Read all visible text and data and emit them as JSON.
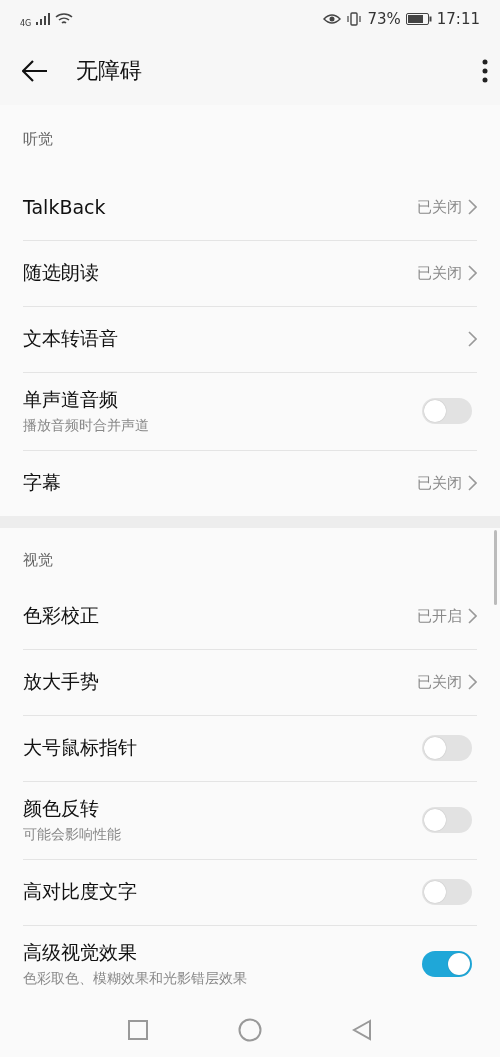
{
  "status_bar": {
    "network": "4G",
    "battery_percent": "73%",
    "time": "17:11"
  },
  "header": {
    "title": "无障碍"
  },
  "sections": [
    {
      "title": "听觉",
      "items": [
        {
          "kind": "link",
          "label": "TalkBack",
          "value": "已关闭"
        },
        {
          "kind": "link",
          "label": "随选朗读",
          "value": "已关闭"
        },
        {
          "kind": "link",
          "label": "文本转语音"
        },
        {
          "kind": "switch",
          "label": "单声道音频",
          "subtitle": "播放音频时合并声道",
          "on": false
        },
        {
          "kind": "link",
          "label": "字幕",
          "value": "已关闭"
        }
      ]
    },
    {
      "title": "视觉",
      "items": [
        {
          "kind": "link",
          "label": "色彩校正",
          "value": "已开启"
        },
        {
          "kind": "link",
          "label": "放大手势",
          "value": "已关闭"
        },
        {
          "kind": "switch",
          "label": "大号鼠标指针",
          "on": false
        },
        {
          "kind": "switch",
          "label": "颜色反转",
          "subtitle": "可能会影响性能",
          "on": false
        },
        {
          "kind": "switch",
          "label": "高对比度文字",
          "on": false
        },
        {
          "kind": "switch",
          "label": "高级视觉效果",
          "subtitle": "色彩取色、模糊效果和光影错层效果",
          "on": true
        }
      ]
    }
  ]
}
